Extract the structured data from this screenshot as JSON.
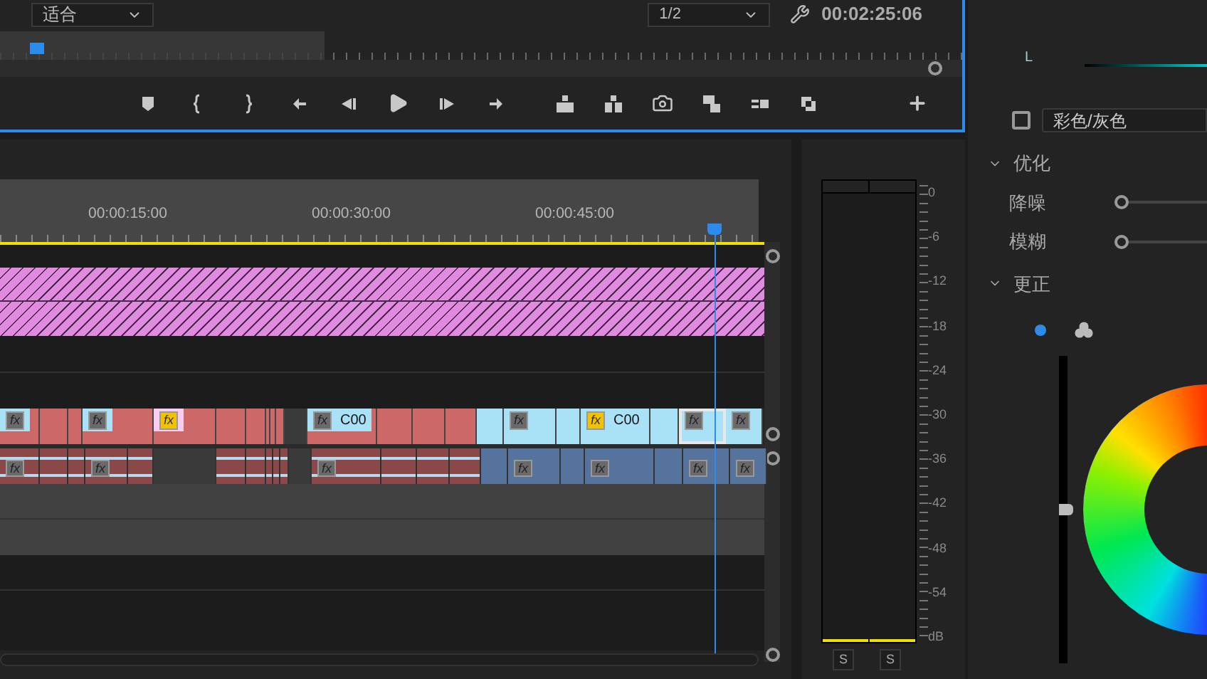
{
  "monitor": {
    "zoom": "适合",
    "resolution": "1/2",
    "timecode": "00:02:25:06"
  },
  "timeline": {
    "ruler": [
      "00:00:15:00",
      "00:00:30:00",
      "00:00:45:00"
    ],
    "video_clips": [
      {
        "kind": "red",
        "fx": "fx",
        "fx_on": false,
        "selected": false
      },
      {
        "kind": "red",
        "selected": false
      },
      {
        "kind": "red",
        "selected": false
      },
      {
        "kind": "red",
        "fx": "fx",
        "fx_on": false,
        "selected": false
      },
      {
        "kind": "red",
        "fx": "fx",
        "fx_on": true,
        "selected": false
      },
      {
        "kind": "red",
        "selected": false
      },
      {
        "kind": "red",
        "selected": false
      },
      {
        "kind": "red",
        "selected": false
      },
      {
        "kind": "red",
        "selected": false
      },
      {
        "kind": "red",
        "selected": false
      },
      {
        "kind": "gap",
        "selected": false
      },
      {
        "kind": "red",
        "fx": "fx",
        "fx_on": false,
        "label": "C00",
        "selected": false
      },
      {
        "kind": "red",
        "selected": false
      },
      {
        "kind": "red",
        "selected": false
      },
      {
        "kind": "red",
        "selected": false
      },
      {
        "kind": "blue",
        "selected": false
      },
      {
        "kind": "blue",
        "fx": "fx",
        "fx_on": false,
        "selected": false
      },
      {
        "kind": "blue",
        "selected": false
      },
      {
        "kind": "blue",
        "fx": "fx",
        "fx_on": true,
        "label": "C00",
        "selected": false
      },
      {
        "kind": "blue",
        "selected": false
      },
      {
        "kind": "blue",
        "fx": "fx",
        "fx_on": false,
        "selected": true
      },
      {
        "kind": "blue",
        "fx": "fx",
        "fx_on": false,
        "selected": false
      }
    ],
    "audio_clips": [
      {
        "kind": "red",
        "fx": "fx"
      },
      {
        "kind": "red"
      },
      {
        "kind": "red"
      },
      {
        "kind": "red",
        "fx": "fx"
      },
      {
        "kind": "red"
      },
      {
        "kind": "gap"
      },
      {
        "kind": "red"
      },
      {
        "kind": "red"
      },
      {
        "kind": "red"
      },
      {
        "kind": "red"
      },
      {
        "kind": "red"
      },
      {
        "kind": "gap"
      },
      {
        "kind": "red",
        "fx": "fx"
      },
      {
        "kind": "red"
      },
      {
        "kind": "red"
      },
      {
        "kind": "red"
      },
      {
        "kind": "blue"
      },
      {
        "kind": "blue",
        "fx": "fx"
      },
      {
        "kind": "blue"
      },
      {
        "kind": "blue",
        "fx": "fx"
      },
      {
        "kind": "blue"
      },
      {
        "kind": "blue",
        "fx": "fx"
      },
      {
        "kind": "blue",
        "fx": "fx"
      }
    ]
  },
  "audio_meter": {
    "scale": [
      "0",
      "-6",
      "-12",
      "-18",
      "-24",
      "-30",
      "-36",
      "-42",
      "-48",
      "-54",
      "dB"
    ],
    "solo_buttons": [
      "S",
      "S"
    ]
  },
  "lumetri": {
    "channel_label": "L",
    "color_gray": {
      "checked": false,
      "label": "彩色/灰色"
    },
    "sections": [
      {
        "title": "优化",
        "expanded": true,
        "sliders": [
          {
            "label": "降噪",
            "level": 0
          },
          {
            "label": "模糊",
            "level": 0
          }
        ]
      },
      {
        "title": "更正",
        "expanded": true
      }
    ],
    "wheel_modes": [
      {
        "kind": "single",
        "selected": true
      },
      {
        "kind": "triple",
        "selected": false
      }
    ],
    "luma_slider": {
      "level": 0.5
    }
  }
}
